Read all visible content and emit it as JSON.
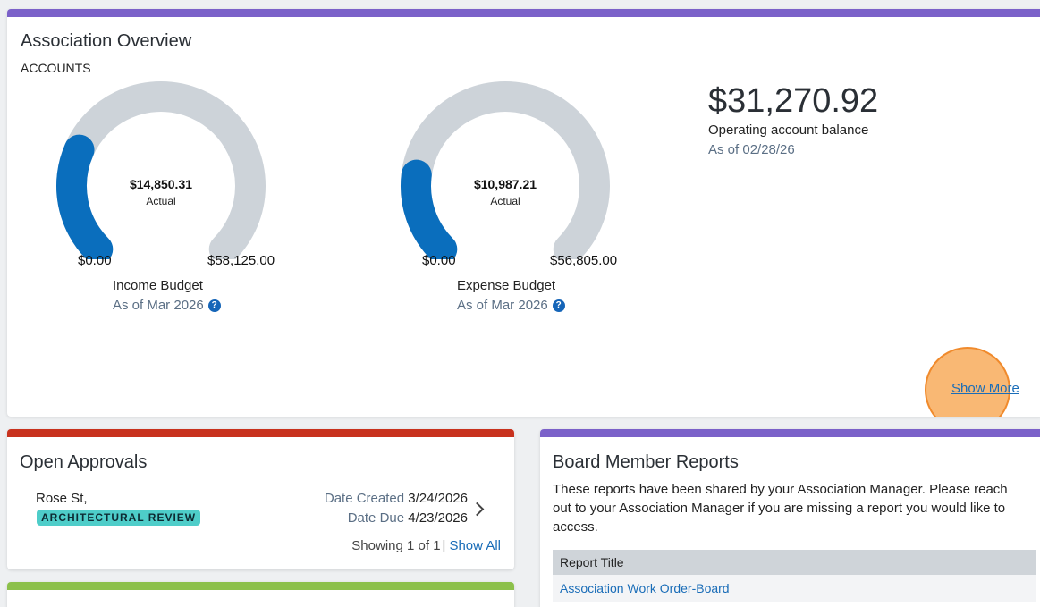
{
  "overview": {
    "title": "Association Overview",
    "section_label": "ACCOUNTS",
    "accent_color": "#7b61c9",
    "gauges": [
      {
        "value": "$14,850.31",
        "value_label": "Actual",
        "min": "$0.00",
        "max": "$58,125.00",
        "name": "Income Budget",
        "as_of": "As of Mar 2026",
        "fraction": 0.255
      },
      {
        "value": "$10,987.21",
        "value_label": "Actual",
        "min": "$0.00",
        "max": "$56,805.00",
        "name": "Expense Budget",
        "as_of": "As of Mar 2026",
        "fraction": 0.193
      }
    ],
    "balance": {
      "amount": "$31,270.92",
      "label": "Operating account balance",
      "as_of": "As of 02/28/26"
    },
    "show_more": "Show More",
    "gauge_track_color": "#cdd3d9",
    "gauge_fill_color": "#0a6ebd"
  },
  "approvals": {
    "title": "Open Approvals",
    "accent_color": "#c8321e",
    "item": {
      "location": "Rose St,",
      "badge": "ARCHITECTURAL REVIEW",
      "date_created_label": "Date Created",
      "date_created": "3/24/2026",
      "date_due_label": "Date Due",
      "date_due": "4/23/2026"
    },
    "showing": "Showing 1 of 1",
    "show_all": "Show All"
  },
  "reports": {
    "title": "Board Member Reports",
    "accent_color": "#7b61c9",
    "description": "These reports have been shared by your Association Manager. Please reach out to your Association Manager if you are missing a report you would like to access.",
    "column_header": "Report Title",
    "rows": [
      "Association Work Order-Board"
    ]
  },
  "fourth_card": {
    "accent_color": "#8cc04b"
  }
}
